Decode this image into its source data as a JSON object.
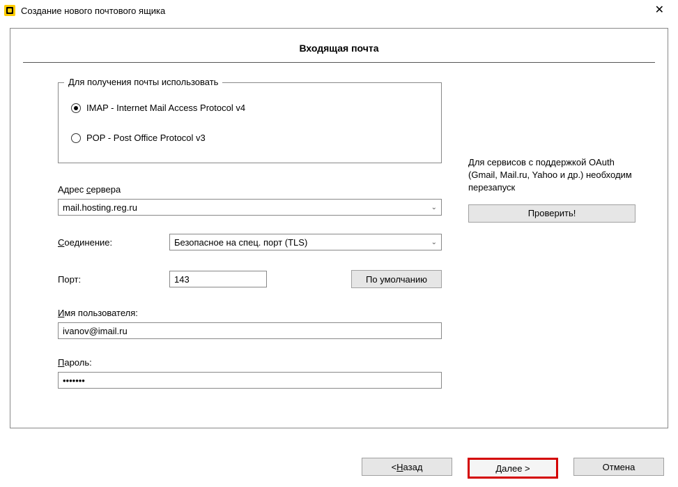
{
  "window": {
    "title": "Создание нового почтового ящика"
  },
  "page": {
    "heading": "Входящая почта"
  },
  "protocol": {
    "legend": "Для получения почты использовать",
    "imap_label": "IMAP - Internet Mail Access Protocol v4",
    "pop_label": "POP  -  Post Office Protocol v3",
    "selected": "imap"
  },
  "server": {
    "label_pre": "Адрес ",
    "label_u": "с",
    "label_post": "ервера",
    "value": "mail.hosting.reg.ru"
  },
  "connection": {
    "label_u": "С",
    "label_post": "оединение:",
    "value": "Безопасное на спец. порт (TLS)"
  },
  "port": {
    "label": "Порт:",
    "value": "143",
    "default_btn": "По умолчанию"
  },
  "username": {
    "label_u": "И",
    "label_post": "мя пользователя:",
    "value": "ivanov@imail.ru"
  },
  "password": {
    "label_u": "П",
    "label_post": "ароль:",
    "value": "•••••••"
  },
  "oauth": {
    "note": "Для сервисов с поддержкой OAuth (Gmail, Mail.ru, Yahoo и др.) необходим перезапуск",
    "verify_btn": "Проверить!"
  },
  "footer": {
    "back_pre": "<  ",
    "back_u": "Н",
    "back_post": "азад",
    "next": "Далее   >",
    "cancel": "Отмена"
  }
}
